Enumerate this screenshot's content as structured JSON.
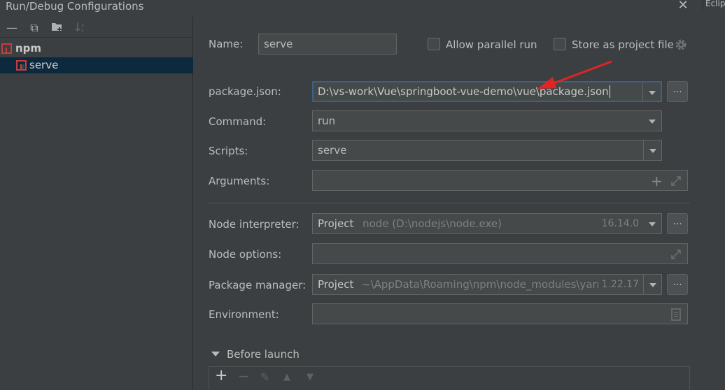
{
  "window": {
    "title": "Run/Debug Configurations",
    "close": "✕",
    "corner_fragment": "Eclips"
  },
  "left_toolbar": {
    "add": "—",
    "copy": "⧉",
    "folder": "▆",
    "sort": "↓"
  },
  "tree": {
    "group": "npm",
    "item": "serve"
  },
  "form": {
    "name_label": "Name:",
    "name_value": "serve",
    "allow_parallel": "Allow parallel run",
    "store_project": "Store as project file",
    "package_label": "package.json:",
    "package_value": "D:\\vs-work\\Vue\\springboot-vue-demo\\vue\\package.json",
    "command_label": "Command:",
    "command_value": "run",
    "scripts_label": "Scripts:",
    "scripts_value": "serve",
    "arguments_label": "Arguments:",
    "node_interpreter_label": "Node interpreter:",
    "node_interpreter_kind": "Project",
    "node_interpreter_path": "node (D:\\nodejs\\node.exe)",
    "node_interpreter_version": "16.14.0",
    "node_options_label": "Node options:",
    "package_manager_label": "Package manager:",
    "package_manager_kind": "Project",
    "package_manager_path": "~\\AppData\\Roaming\\npm\\node_modules\\yarn",
    "package_manager_version": "1.22.17",
    "environment_label": "Environment:",
    "dots": "..."
  },
  "before_launch": {
    "label": "Before launch",
    "add": "+",
    "remove": "−",
    "edit": "✎",
    "up": "▲",
    "down": "▼"
  },
  "colors": {
    "annotation_arrow": "#e02424",
    "selection": "#0d293e"
  }
}
